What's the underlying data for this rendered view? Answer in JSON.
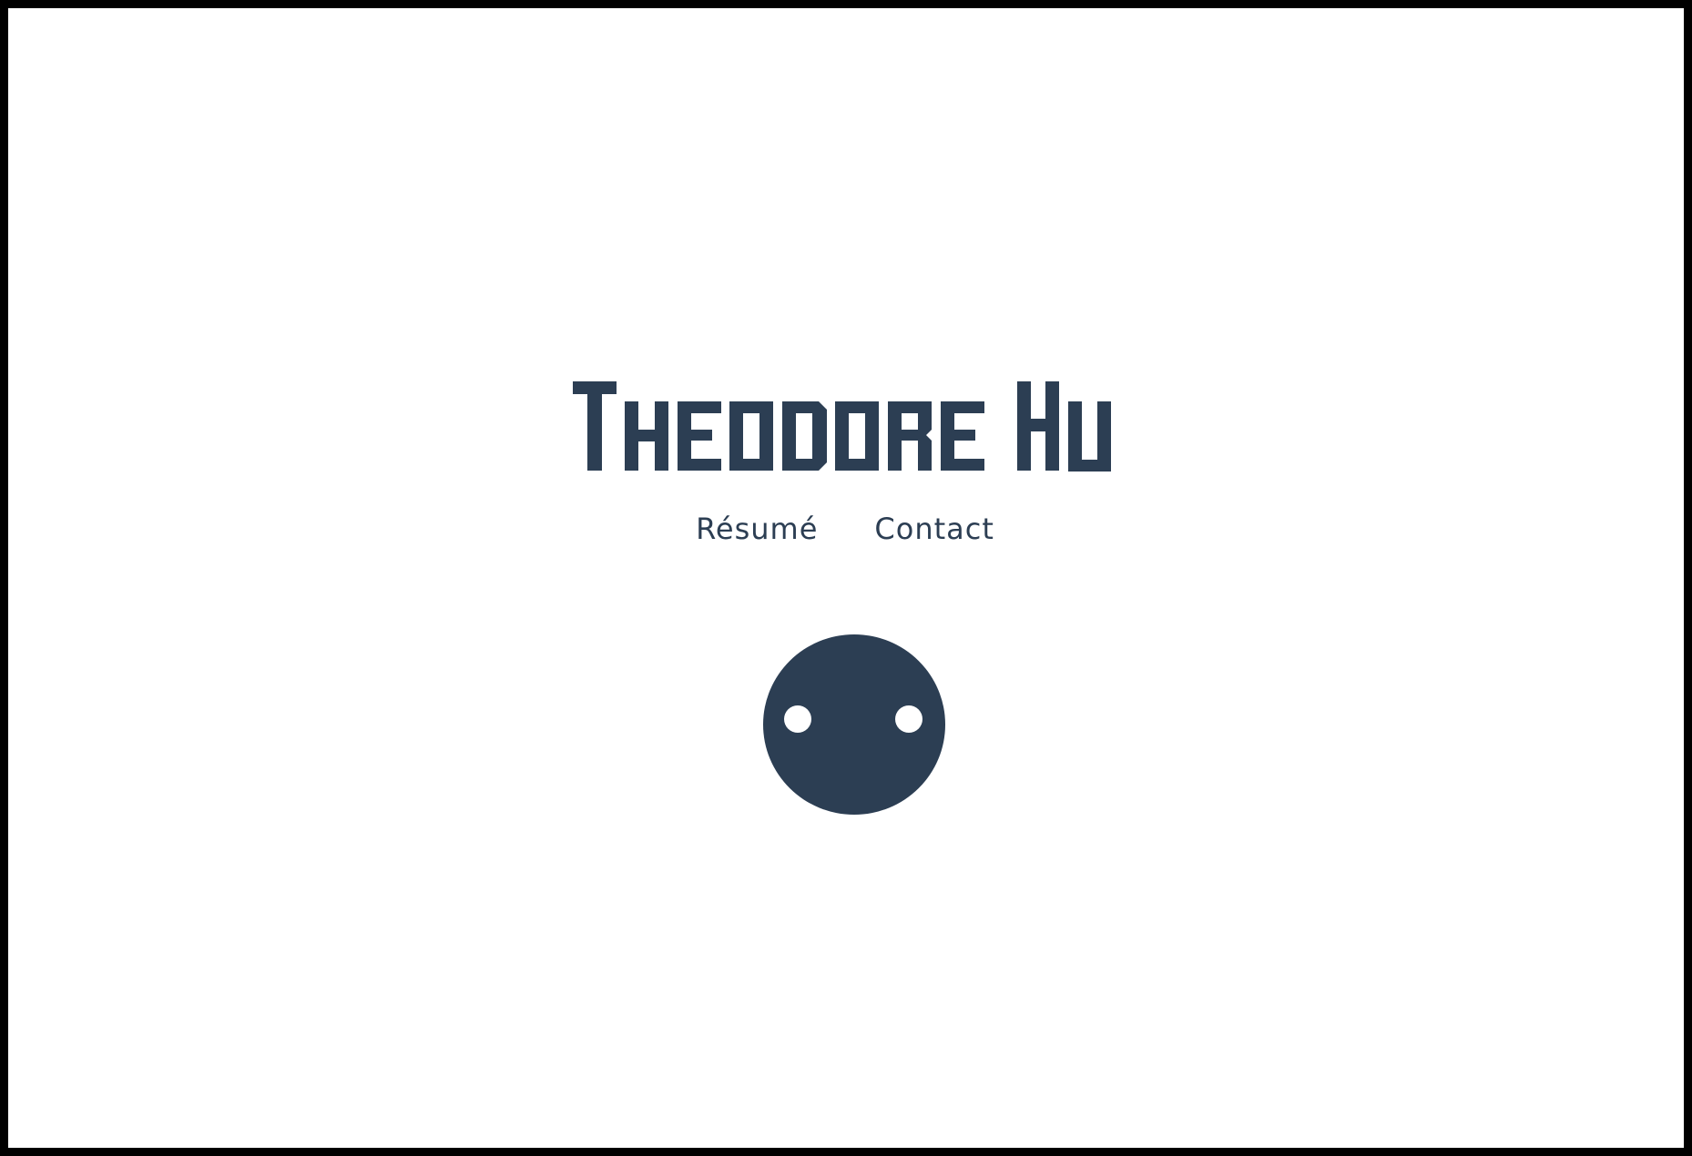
{
  "site": {
    "title": "Theodore Hu"
  },
  "nav": {
    "items": [
      {
        "label": "Résumé"
      },
      {
        "label": "Contact"
      }
    ]
  },
  "mascot": {
    "icon": "round-face-icon"
  },
  "colors": {
    "brand": "#2c3e53",
    "background": "#ffffff",
    "frame": "#000000",
    "eyes": "#ffffff"
  }
}
